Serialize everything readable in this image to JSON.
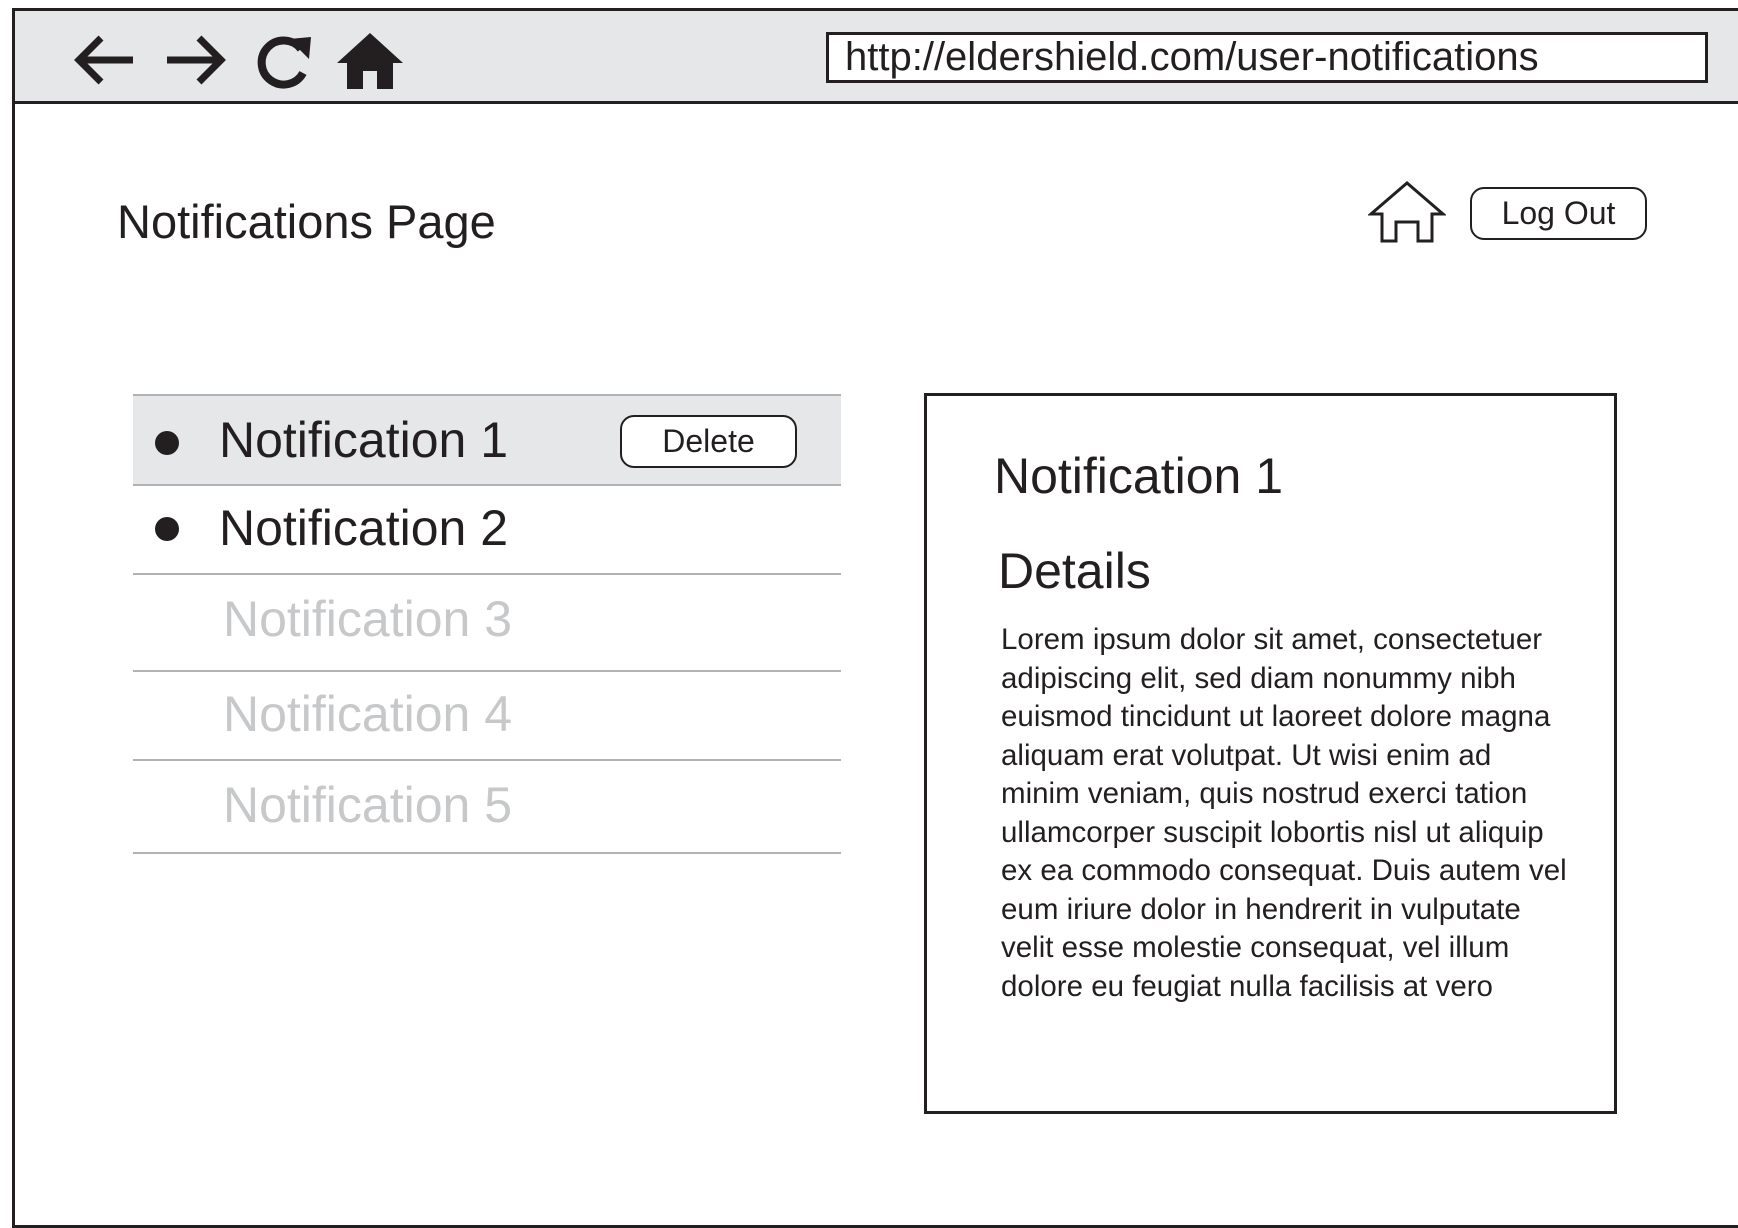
{
  "browser": {
    "url": "http://eldershield.com/user-notifications"
  },
  "header": {
    "title": "Notifications Page",
    "logout_label": "Log Out"
  },
  "notifications": [
    {
      "label": "Notification 1",
      "state": "unread",
      "selected": true
    },
    {
      "label": "Notification 2",
      "state": "unread",
      "selected": false
    },
    {
      "label": "Notification 3",
      "state": "read",
      "selected": false
    },
    {
      "label": "Notification 4",
      "state": "read",
      "selected": false
    },
    {
      "label": "Notification 5",
      "state": "read",
      "selected": false
    }
  ],
  "list": {
    "delete_label": "Delete"
  },
  "detail": {
    "title": "Notification 1",
    "heading": "Details",
    "body": "Lorem ipsum dolor sit amet, consectetuer adipiscing elit, sed diam nonummy nibh euismod tincidunt ut laoreet dolore magna aliquam erat volutpat. Ut wisi enim ad minim veniam, quis nostrud exerci tation ullamcorper suscipit lobortis nisl ut aliquip ex ea commodo consequat. Duis autem vel eum iriure dolor in hendrerit in vulputate velit esse molestie consequat, vel illum dolore eu feugiat nulla facilisis at vero"
  },
  "colors": {
    "ink": "#231f20",
    "bar_gray": "#e6e7e8",
    "read_text": "#c7c8ca",
    "divider": "#b0b2b4"
  }
}
